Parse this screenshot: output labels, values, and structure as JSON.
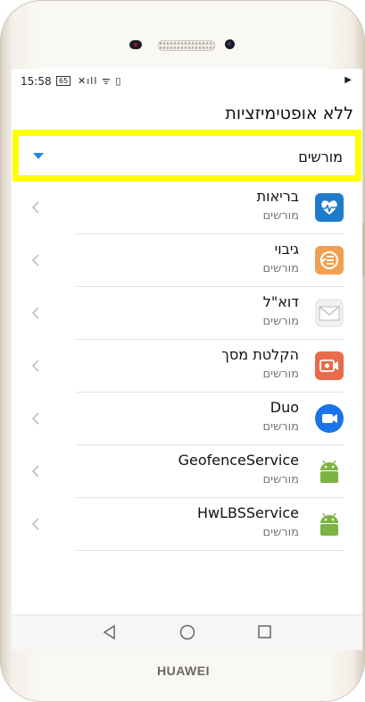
{
  "status_bar": {
    "time": "15:58",
    "battery": "65",
    "icons": "✕ıll ᯤ ▯",
    "right_icon": "▶"
  },
  "header": {
    "title": "ללא אופטימיזציות"
  },
  "filter": {
    "selected": "מורשים",
    "accent_color": "#1e88e5",
    "highlight_color": "#ffff00"
  },
  "apps": [
    {
      "name": "בריאות",
      "status": "מורשים",
      "icon": "health-icon"
    },
    {
      "name": "גיבוי",
      "status": "מורשים",
      "icon": "backup-icon"
    },
    {
      "name": "דוא\"ל",
      "status": "מורשים",
      "icon": "email-icon"
    },
    {
      "name": "הקלטת מסך",
      "status": "מורשים",
      "icon": "screen-recorder-icon"
    },
    {
      "name": "Duo",
      "status": "מורשים",
      "icon": "duo-icon"
    },
    {
      "name": "GeofenceService",
      "status": "מורשים",
      "icon": "android-icon"
    },
    {
      "name": "HwLBSService",
      "status": "מורשים",
      "icon": "android-icon"
    }
  ],
  "device": {
    "brand": "HUAWEI"
  }
}
